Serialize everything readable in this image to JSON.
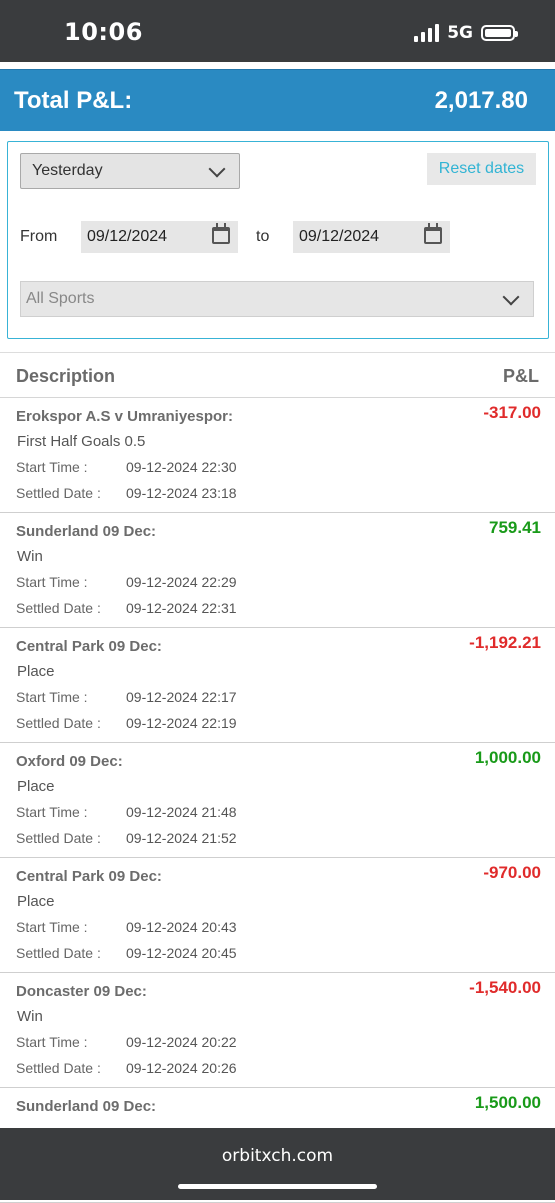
{
  "status_bar": {
    "time": "10:06",
    "network": "5G"
  },
  "header": {
    "title": "Total P&L:",
    "total": "2,017.80"
  },
  "filters": {
    "period": "Yesterday",
    "reset_label": "Reset dates",
    "from_label": "From",
    "from_date": "09/12/2024",
    "to_label": "to",
    "to_date": "09/12/2024",
    "sport": "All Sports"
  },
  "table": {
    "col_description": "Description",
    "col_pl": "P&L",
    "start_label": "Start Time :",
    "settled_label": "Settled Date :",
    "rows": [
      {
        "title": "Erokspor A.S v Umraniyespor:",
        "market": "First Half Goals 0.5",
        "start": "09-12-2024 22:30",
        "settled": "09-12-2024 23:18",
        "amount": "-317.00",
        "sign": "neg"
      },
      {
        "title": "Sunderland 09 Dec:",
        "market": "Win",
        "start": "09-12-2024 22:29",
        "settled": "09-12-2024 22:31",
        "amount": "759.41",
        "sign": "pos"
      },
      {
        "title": "Central Park 09 Dec:",
        "market": "Place",
        "start": "09-12-2024 22:17",
        "settled": "09-12-2024 22:19",
        "amount": "-1,192.21",
        "sign": "neg"
      },
      {
        "title": "Oxford 09 Dec:",
        "market": "Place",
        "start": "09-12-2024 21:48",
        "settled": "09-12-2024 21:52",
        "amount": "1,000.00",
        "sign": "pos"
      },
      {
        "title": "Central Park 09 Dec:",
        "market": "Place",
        "start": "09-12-2024 20:43",
        "settled": "09-12-2024 20:45",
        "amount": "-970.00",
        "sign": "neg"
      },
      {
        "title": "Doncaster 09 Dec:",
        "market": "Win",
        "start": "09-12-2024 20:22",
        "settled": "09-12-2024 20:26",
        "amount": "-1,540.00",
        "sign": "neg"
      },
      {
        "title": "Sunderland 09 Dec:",
        "market": "",
        "start": "",
        "settled": "",
        "amount": "1,500.00",
        "sign": "pos"
      }
    ]
  },
  "browser": {
    "domain": "orbitxch.com"
  },
  "colors": {
    "header_bg": "#2a8ac2",
    "positive": "#199a19",
    "negative": "#e02b2b",
    "accent": "#38b3d6"
  }
}
